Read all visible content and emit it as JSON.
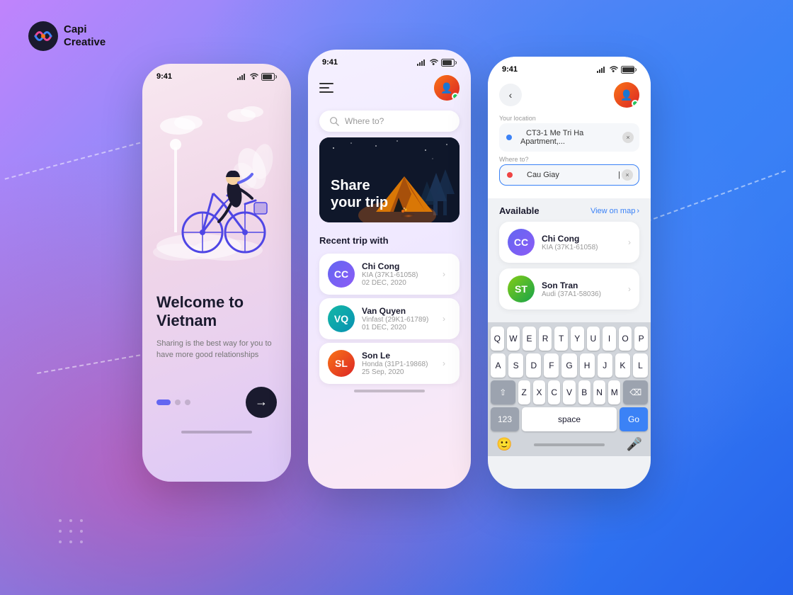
{
  "brand": {
    "name_line1": "Capi",
    "name_line2": "Creative"
  },
  "phone1": {
    "status_time": "9:41",
    "welcome_title": "Welcome to Vietnam",
    "welcome_subtitle": "Sharing is the best way for you to have more good relationships",
    "next_arrow": "→",
    "dots": [
      "active",
      "inactive",
      "inactive"
    ]
  },
  "phone2": {
    "status_time": "9:41",
    "search_placeholder": "Where to?",
    "banner_text_line1": "Share",
    "banner_text_line2": "your trip",
    "section_title": "Recent trip with",
    "trips": [
      {
        "name": "Chi Cong",
        "car": "KIA (37K1-61058)",
        "date": "02 DEC, 2020",
        "initials": "CC"
      },
      {
        "name": "Van Quyen",
        "car": "Vinfast (29K1-61789)",
        "date": "01 DEC, 2020",
        "initials": "VQ"
      },
      {
        "name": "Son Le",
        "car": "Honda (31P1-19868)",
        "date": "25 Sep, 2020",
        "initials": "SL"
      }
    ]
  },
  "phone3": {
    "status_time": "9:41",
    "your_location_label": "Your location",
    "from_address": "CT3-1 Me Tri Ha Apartment,...",
    "where_to_label": "Where to?",
    "to_address": "Cau Giay",
    "available_title": "Available",
    "view_map_label": "View on map",
    "drivers": [
      {
        "name": "Chi Cong",
        "car": "KIA (37K1-61058)",
        "initials": "CC"
      },
      {
        "name": "Son Tran",
        "car": "Audi (37A1-58036)",
        "initials": "ST"
      }
    ],
    "keyboard": {
      "row1": [
        "Q",
        "W",
        "E",
        "R",
        "T",
        "Y",
        "U",
        "I",
        "O",
        "P"
      ],
      "row2": [
        "A",
        "S",
        "D",
        "F",
        "G",
        "H",
        "J",
        "K",
        "L"
      ],
      "row3": [
        "Z",
        "X",
        "C",
        "V",
        "B",
        "N",
        "M"
      ],
      "num_label": "123",
      "space_label": "space",
      "go_label": "Go"
    }
  }
}
